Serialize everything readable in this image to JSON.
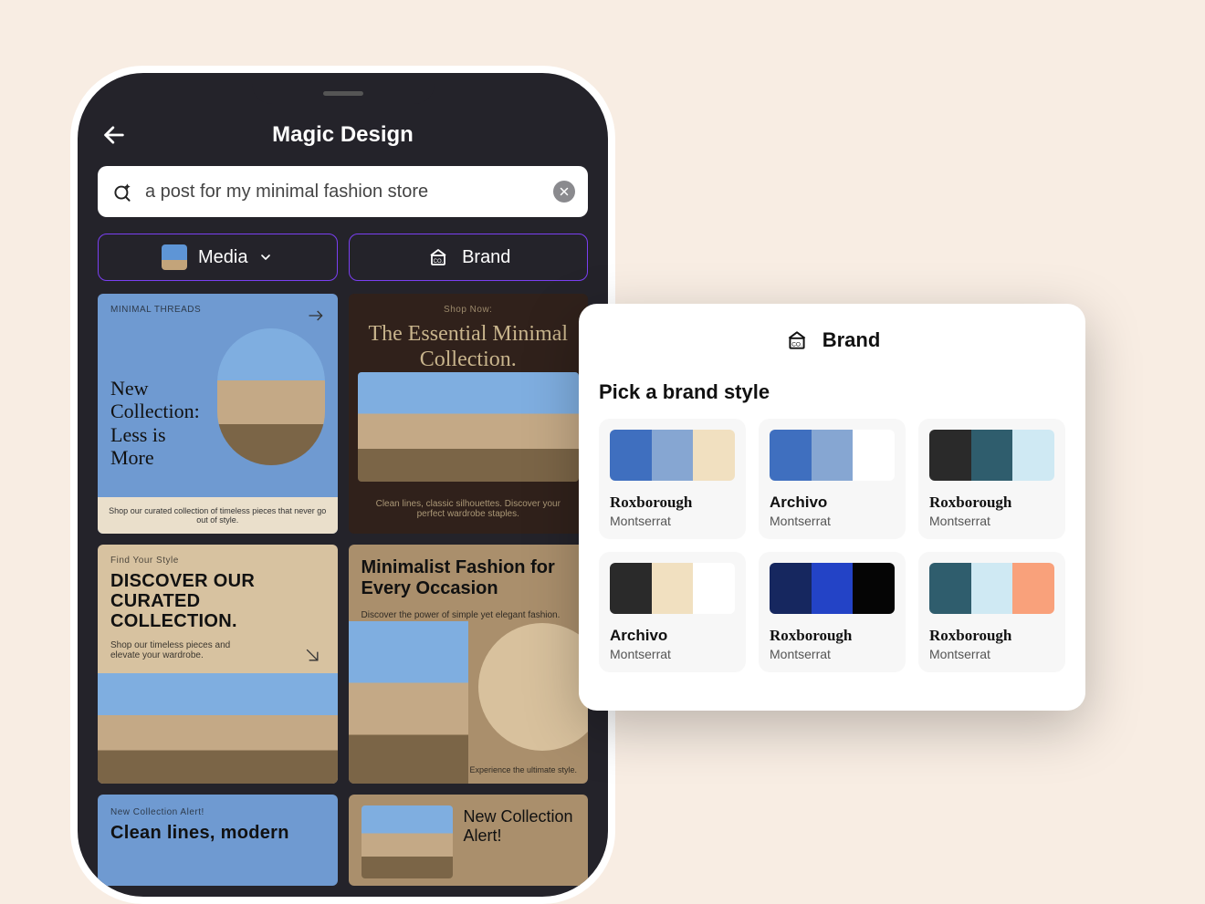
{
  "app": {
    "title": "Magic Design"
  },
  "search": {
    "value": "a post for my minimal fashion store"
  },
  "pills": {
    "media": "Media",
    "brand": "Brand"
  },
  "cards": [
    {
      "head": "MINIMAL THREADS",
      "big": "New Collection: Less is More",
      "footer": "Shop our curated collection of timeless pieces that never go out of style."
    },
    {
      "head": "Shop Now:",
      "big": "The Essential Minimal Collection.",
      "sub": "Clean lines, classic silhouettes. Discover your perfect wardrobe staples."
    },
    {
      "head": "Find Your Style",
      "bigsans": "DISCOVER OUR CURATED COLLECTION.",
      "sub": "Shop our timeless pieces and elevate your wardrobe."
    },
    {
      "big": "Minimalist Fashion for Every Occasion",
      "sub": "Discover the power of simple yet elegant fashion.",
      "exp": "Experience the ultimate style."
    },
    {
      "head": "New Collection Alert!",
      "bigsans": "Clean lines, modern"
    },
    {
      "big": "New Collection Alert!"
    }
  ],
  "popover": {
    "title": "Brand",
    "pick": "Pick a brand style",
    "options": [
      {
        "heading": "Roxborough",
        "sub": "Montserrat",
        "heading_style": "serif",
        "colors": [
          "#3f6fbf",
          "#86a6d2",
          "#f1e0c0"
        ]
      },
      {
        "heading": "Archivo",
        "sub": "Montserrat",
        "heading_style": "sans",
        "colors": [
          "#3f6fbf",
          "#86a6d2",
          "#ffffff"
        ]
      },
      {
        "heading": "Roxborough",
        "sub": "Montserrat",
        "heading_style": "serif",
        "colors": [
          "#2a2a2a",
          "#2f5d6d",
          "#cfe9f3"
        ]
      },
      {
        "heading": "Archivo",
        "sub": "Montserrat",
        "heading_style": "sans",
        "colors": [
          "#2a2a2a",
          "#f1e0c0",
          "#ffffff"
        ]
      },
      {
        "heading": "Roxborough",
        "sub": "Montserrat",
        "heading_style": "serif",
        "colors": [
          "#16275f",
          "#2343c6",
          "#050505"
        ]
      },
      {
        "heading": "Roxborough",
        "sub": "Montserrat",
        "heading_style": "serif",
        "colors": [
          "#2f5d6d",
          "#cfe9f3",
          "#f9a17b"
        ]
      }
    ]
  }
}
